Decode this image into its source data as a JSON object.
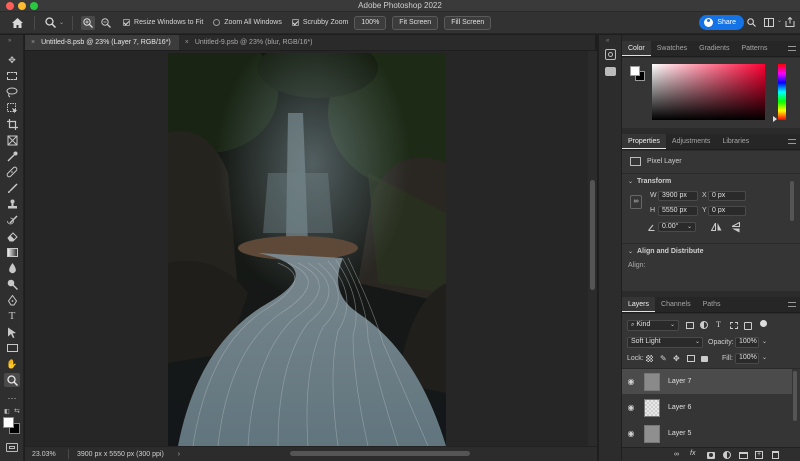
{
  "window": {
    "title": "Adobe Photoshop 2022"
  },
  "options_bar": {
    "resize_windows_to_fit": "Resize Windows to Fit",
    "zoom_all_windows": "Zoom All Windows",
    "scrubby_zoom": "Scrubby Zoom",
    "zoom_value": "100%",
    "fit_screen": "Fit Screen",
    "fill_screen": "Fill Screen",
    "share": "Share"
  },
  "tabs": [
    {
      "label": "Untitled-8.psb @ 23% (Layer 7, RGB/16*)",
      "active": true
    },
    {
      "label": "Untitled-9.psb @ 23% (blur, RGB/16*)",
      "active": false
    }
  ],
  "status": {
    "zoom": "23.03%",
    "doc_info": "3900 px x 5550 px (300 ppi)"
  },
  "color_panel": {
    "tabs": [
      "Color",
      "Swatches",
      "Gradients",
      "Patterns"
    ],
    "hue_color": "#ff0033"
  },
  "properties_panel": {
    "tabs": [
      "Properties",
      "Adjustments",
      "Libraries"
    ],
    "layer_type": "Pixel Layer",
    "transform_heading": "Transform",
    "w_label": "W",
    "w_value": "3900 px",
    "h_label": "H",
    "h_value": "5550 px",
    "x_label": "X",
    "x_value": "0 px",
    "y_label": "Y",
    "y_value": "0 px",
    "angle_value": "0.00°",
    "align_heading": "Align and Distribute",
    "align_label": "Align:"
  },
  "layers_panel": {
    "tabs": [
      "Layers",
      "Channels",
      "Paths"
    ],
    "filter": "Kind",
    "blend_mode": "Soft Light",
    "opacity_label": "Opacity:",
    "opacity_value": "100%",
    "lock_label": "Lock:",
    "fill_label": "Fill:",
    "fill_value": "100%",
    "layers": [
      {
        "name": "Layer 7",
        "selected": true
      },
      {
        "name": "Layer 6",
        "selected": false
      },
      {
        "name": "Layer 5",
        "selected": false
      }
    ]
  },
  "colors": {
    "accent": "#1473e6",
    "panel_bg": "#353535",
    "app_bg": "#262626"
  }
}
